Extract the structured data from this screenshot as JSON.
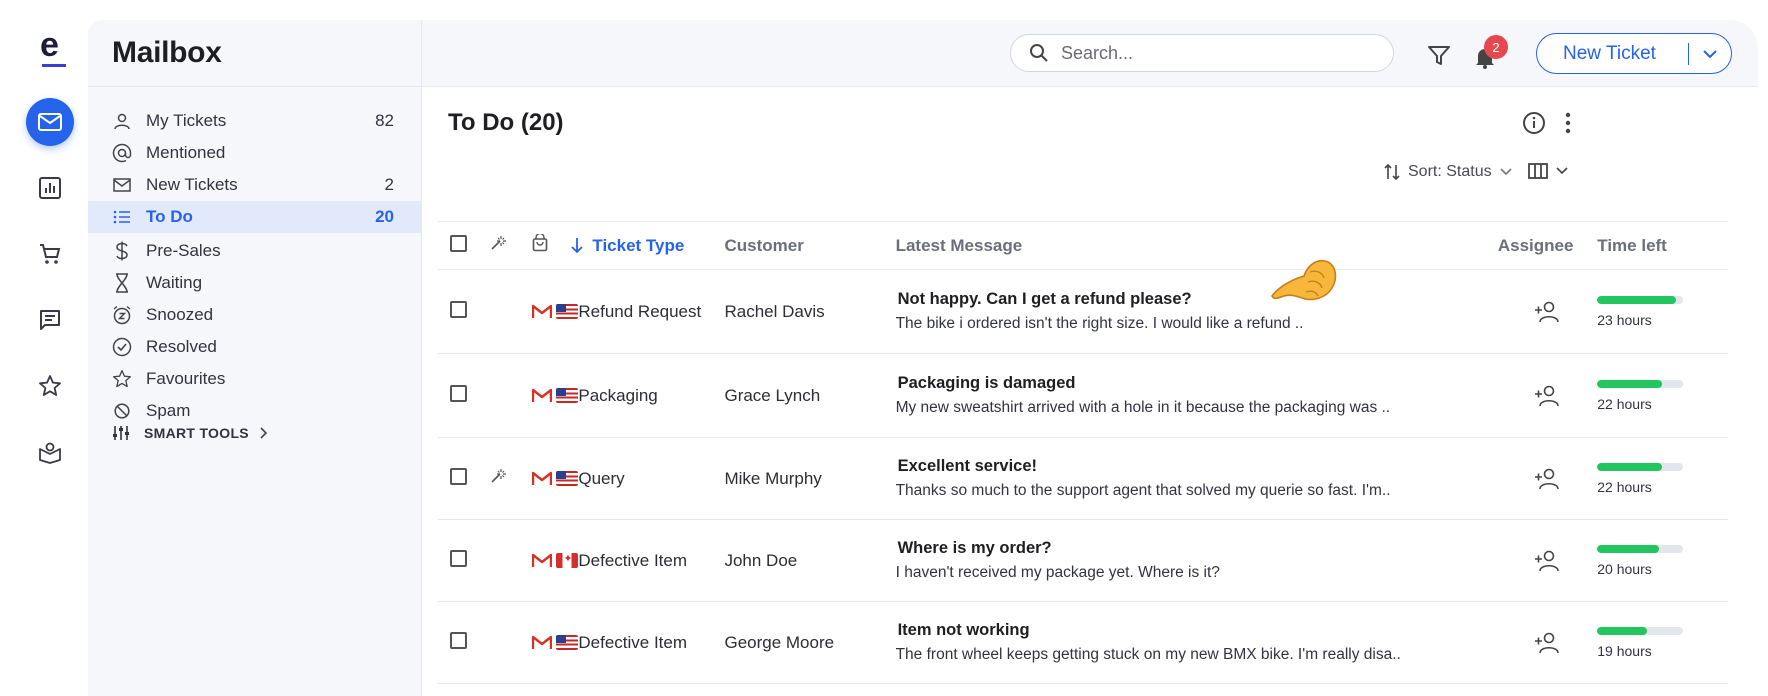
{
  "app": {
    "title": "Mailbox"
  },
  "search": {
    "placeholder": "Search..."
  },
  "notifications": {
    "count": "2"
  },
  "new_ticket": {
    "label": "New Ticket"
  },
  "rail": {
    "items": [
      "mail-icon",
      "analytics-icon",
      "cart-icon",
      "chat-icon",
      "star-icon",
      "help-book-icon"
    ],
    "active": "mail-icon"
  },
  "sidebar": {
    "items": [
      {
        "label": "My Tickets",
        "count": "82",
        "icon": "person-icon"
      },
      {
        "label": "Mentioned",
        "count": "",
        "icon": "at-icon"
      },
      {
        "label": "New Tickets",
        "count": "2",
        "icon": "envelope-icon"
      },
      {
        "label": "To Do",
        "count": "20",
        "icon": "list-icon",
        "active": true
      },
      {
        "label": "Pre-Sales",
        "count": "",
        "icon": "dollar-icon"
      },
      {
        "label": "Waiting",
        "count": "",
        "icon": "hourglass-icon"
      },
      {
        "label": "Snoozed",
        "count": "",
        "icon": "alarm-icon"
      },
      {
        "label": "Resolved",
        "count": "",
        "icon": "check-circle-icon"
      },
      {
        "label": "Favourites",
        "count": "",
        "icon": "star-icon"
      },
      {
        "label": "Spam",
        "count": "",
        "icon": "block-icon"
      }
    ],
    "smart_tools": "SMART TOOLS"
  },
  "list": {
    "title": "To Do (20)",
    "sort_label": "Sort: Status",
    "columns": {
      "ticket_type": "Ticket Type",
      "customer": "Customer",
      "latest_message": "Latest Message",
      "assignee": "Assignee",
      "time_left": "Time left"
    },
    "rows": [
      {
        "ai": false,
        "flag": "us",
        "type": "Refund Request",
        "customer": "Rachel Davis",
        "subject": "Not happy. Can I get a refund please?",
        "message": "The bike i ordered isn't the right size. I would like a refund ..",
        "time_left": "23 hours",
        "progress": 0.92
      },
      {
        "ai": false,
        "flag": "us",
        "type": "Packaging",
        "customer": "Grace Lynch",
        "subject": "Packaging is damaged",
        "message": "My new sweatshirt arrived with a hole in it because the packaging was ..",
        "time_left": "22 hours",
        "progress": 0.75
      },
      {
        "ai": true,
        "flag": "us",
        "type": "Query",
        "customer": "Mike Murphy",
        "subject": "Excellent service!",
        "message": "Thanks so much to the support agent that solved my querie so fast. I'm..",
        "time_left": "22 hours",
        "progress": 0.75
      },
      {
        "ai": false,
        "flag": "ca",
        "type": "Defective Item",
        "customer": "John Doe",
        "subject": "Where is my order?",
        "message": "I haven't received my package yet. Where is it?",
        "time_left": "20 hours",
        "progress": 0.72
      },
      {
        "ai": false,
        "flag": "us",
        "type": "Defective Item",
        "customer": "George Moore",
        "subject": "Item not working",
        "message": "The front wheel keeps getting stuck on my new BMX bike. I'm really disa..",
        "time_left": "19 hours",
        "progress": 0.58
      }
    ]
  },
  "colors": {
    "accent": "#2563eb",
    "progress": "#22c55e",
    "badge": "#e5484d"
  }
}
